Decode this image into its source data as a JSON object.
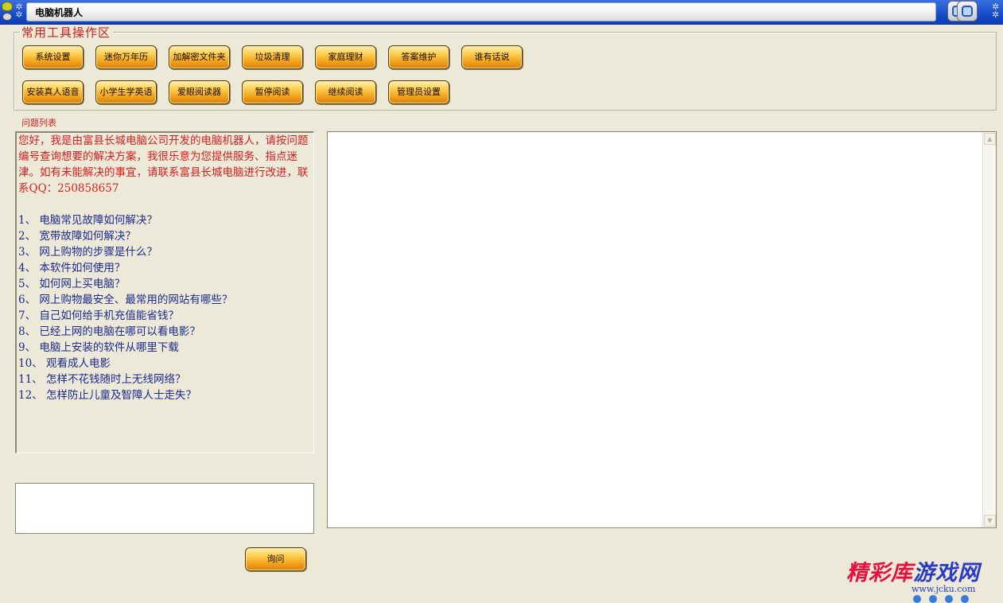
{
  "window": {
    "title": "电脑机器人"
  },
  "tools": {
    "group_title": "常用工具操作区",
    "row1": [
      "系统设置",
      "迷你万年历",
      "加解密文件夹",
      "垃圾清理",
      "家庭理财",
      "答案维护",
      "谁有话说"
    ],
    "row2": [
      "安装真人语音",
      "小学生学英语",
      "爱眼阅读器",
      "暂停阅读",
      "继续阅读",
      "管理员设置"
    ]
  },
  "questions": {
    "section_label": "问题列表",
    "intro": "您好，我是由富县长城电脑公司开发的电脑机器人，请按问题编号查询想要的解决方案，我很乐意为您提供服务、指点迷津。如有未能解决的事宜，请联系富县长城电脑进行改进，联系QQ：250858657",
    "items": [
      "1、 电脑常见故障如何解决？",
      "2、 宽带故障如何解决？",
      "3、 网上购物的步骤是什么？",
      "4、 本软件如何使用？",
      "5、 如何网上买电脑？",
      "6、 网上购物最安全、最常用的网站有哪些？",
      "7、 自己如何给手机充值能省钱？",
      "8、 已经上网的电脑在哪可以看电影？",
      "9、 电脑上安装的软件从哪里下载",
      "10、 观看成人电影",
      "11、 怎样不花钱随时上无线网络？",
      "12、 怎样防止儿童及智障人士走失？"
    ]
  },
  "query": {
    "input_value": "",
    "button_label": "询问"
  },
  "answer": {
    "text": ""
  },
  "watermark": {
    "title_part1": "精彩库",
    "title_part2": "游戏网",
    "url": "www.jcku.com"
  },
  "colors": {
    "titlebar": "#2358d4",
    "button": "#f3a21a",
    "accent_red": "#d42020",
    "question_blue": "#1c2a8c"
  }
}
